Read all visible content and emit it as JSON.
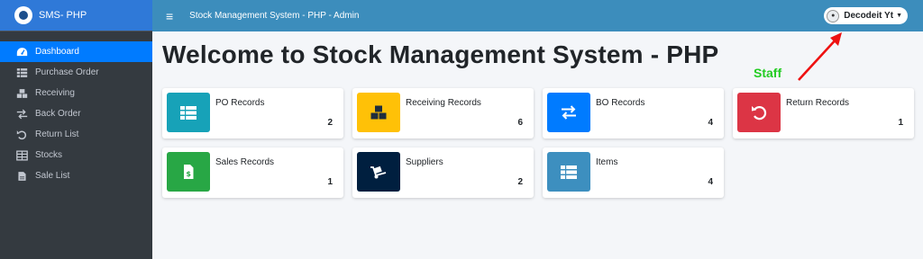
{
  "brand": {
    "name": "SMS- PHP"
  },
  "header": {
    "title": "Stock Management System - PHP - Admin",
    "menu_icon": "hamburger-icon"
  },
  "user": {
    "name": "Decodeit Yt",
    "avatar_icon": "user-avatar-icon"
  },
  "page": {
    "title": "Welcome to Stock Management System - PHP"
  },
  "annotation": {
    "label": "Staff",
    "color": "#22cc22",
    "arrow_color": "#ee1111"
  },
  "sidebar": {
    "items": [
      {
        "label": "Dashboard",
        "icon": "dashboard-icon",
        "active": true
      },
      {
        "label": "Purchase Order",
        "icon": "table-icon"
      },
      {
        "label": "Receiving",
        "icon": "boxes-icon"
      },
      {
        "label": "Back Order",
        "icon": "exchange-icon"
      },
      {
        "label": "Return List",
        "icon": "undo-icon"
      },
      {
        "label": "Stocks",
        "icon": "table-cells-icon"
      },
      {
        "label": "Sale List",
        "icon": "file-invoice-icon"
      }
    ]
  },
  "cards": [
    {
      "label": "PO Records",
      "count": "2",
      "icon": "table-icon",
      "color": "#17a2b8"
    },
    {
      "label": "Receiving Records",
      "count": "6",
      "icon": "boxes-icon",
      "color": "#ffc107"
    },
    {
      "label": "BO Records",
      "count": "4",
      "icon": "exchange-icon",
      "color": "#007bff"
    },
    {
      "label": "Return Records",
      "count": "1",
      "icon": "undo-icon",
      "color": "#dc3545"
    },
    {
      "label": "Sales Records",
      "count": "1",
      "icon": "file-invoice-dollar-icon",
      "color": "#28a745"
    },
    {
      "label": "Suppliers",
      "count": "2",
      "icon": "dolly-icon",
      "color": "#001f3f"
    },
    {
      "label": "Items",
      "count": "4",
      "icon": "list-icon",
      "color": "#3d9970"
    }
  ],
  "colors": {
    "sidebar": "#343a40",
    "header": "#3c8dbc",
    "active": "#007bff"
  }
}
